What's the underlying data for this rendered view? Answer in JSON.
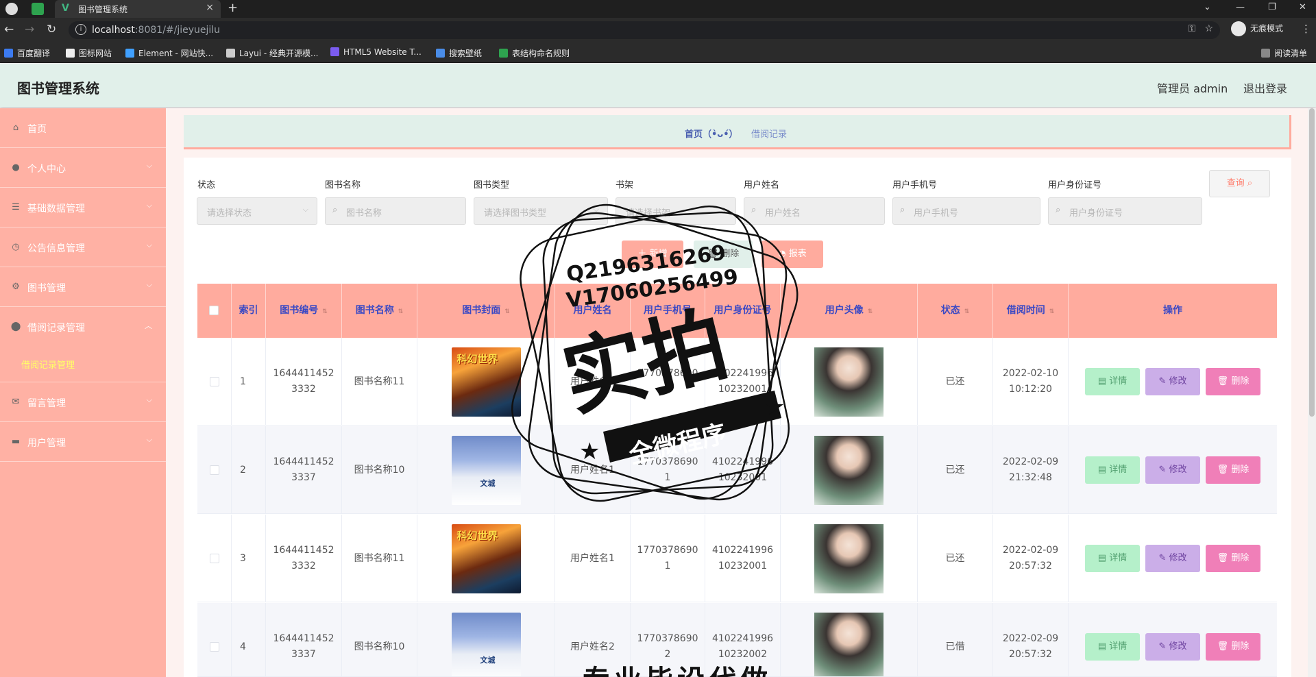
{
  "browser": {
    "tab_title": "图书管理系统",
    "tab_close": "×",
    "new_tab": "+",
    "url_host": "localhost",
    "url_path": ":8081/#/jieyuejilu",
    "incognito_label": "无痕模式",
    "bookmarks": [
      "百度翻译",
      "图标网站",
      "Element - 网站快...",
      "Layui - 经典开源模...",
      "HTML5 Website T...",
      "搜索壁纸",
      "表结构命名规则"
    ],
    "reading_list": "阅读清单"
  },
  "header": {
    "title": "图书管理系统",
    "user": "管理员 admin",
    "logout": "退出登录"
  },
  "sidebar": {
    "items": [
      {
        "label": "首页",
        "icon": "home-icon"
      },
      {
        "label": "个人中心",
        "icon": "user-icon"
      },
      {
        "label": "基础数据管理",
        "icon": "list-icon"
      },
      {
        "label": "公告信息管理",
        "icon": "clock-icon"
      },
      {
        "label": "图书管理",
        "icon": "gear-icon"
      },
      {
        "label": "借阅记录管理",
        "icon": "pin-icon"
      },
      {
        "label": "留言管理",
        "icon": "mail-icon"
      },
      {
        "label": "用户管理",
        "icon": "monitor-icon"
      }
    ],
    "sub_active": "借阅记录管理"
  },
  "breadcrumb": {
    "home": "首页（•̀ᴗ•́）",
    "current": "借阅记录"
  },
  "filters": [
    {
      "label": "状态",
      "placeholder": "请选择状态",
      "type": "select"
    },
    {
      "label": "图书名称",
      "placeholder": "图书名称",
      "type": "search"
    },
    {
      "label": "图书类型",
      "placeholder": "请选择图书类型",
      "type": "select"
    },
    {
      "label": "书架",
      "placeholder": "请选择书架",
      "type": "select"
    },
    {
      "label": "用户姓名",
      "placeholder": "用户姓名",
      "type": "search"
    },
    {
      "label": "用户手机号",
      "placeholder": "用户手机号",
      "type": "search"
    },
    {
      "label": "用户身份证号",
      "placeholder": "用户身份证号",
      "type": "search"
    }
  ],
  "actions": {
    "query": "查询",
    "add": "新增",
    "delete": "删除",
    "report": "报表"
  },
  "table": {
    "headers": [
      "索引",
      "图书编号",
      "图书名称",
      "图书封面",
      "用户姓名",
      "用户手机号",
      "用户身份证号",
      "用户头像",
      "状态",
      "借阅时间",
      "操作"
    ],
    "rows": [
      {
        "index": "1",
        "book_no_1": "1644411452",
        "book_no_2": "3332",
        "book_name": "图书名称11",
        "cover": "科幻世界",
        "user_name": "用户姓名1",
        "phone_1": "1770378690",
        "phone_2": "1",
        "id_1": "4102241996",
        "id_2": "10232001",
        "status": "已还",
        "date": "2022-02-10",
        "time": "10:12:20"
      },
      {
        "index": "2",
        "book_no_1": "1644411452",
        "book_no_2": "3337",
        "book_name": "图书名称10",
        "cover": "文城",
        "user_name": "用户姓名1",
        "phone_1": "1770378690",
        "phone_2": "1",
        "id_1": "4102241996",
        "id_2": "10232001",
        "status": "已还",
        "date": "2022-02-09",
        "time": "21:32:48"
      },
      {
        "index": "3",
        "book_no_1": "1644411452",
        "book_no_2": "3332",
        "book_name": "图书名称11",
        "cover": "科幻世界",
        "user_name": "用户姓名1",
        "phone_1": "1770378690",
        "phone_2": "1",
        "id_1": "4102241996",
        "id_2": "10232001",
        "status": "已还",
        "date": "2022-02-09",
        "time": "20:57:32"
      },
      {
        "index": "4",
        "book_no_1": "1644411452",
        "book_no_2": "3337",
        "book_name": "图书名称10",
        "cover": "文城",
        "user_name": "用户姓名2",
        "phone_1": "1770378690",
        "phone_2": "2",
        "id_1": "4102241996",
        "id_2": "10232002",
        "status": "已借",
        "date": "2022-02-09",
        "time": "20:57:32"
      }
    ],
    "op_detail": "详情",
    "op_edit": "修改",
    "op_delete": "删除"
  },
  "watermark": {
    "qq": "Q2196316269",
    "vx": "V17060256499",
    "big": "实拍",
    "banner": "全微程序",
    "bottom": "专业毕设代做"
  },
  "colors": {
    "header_bg": "#e1f0ea",
    "sidebar_bg": "#ffb1a4",
    "table_head_bg": "#ffab9e",
    "detail_btn": "#b5f0ca",
    "edit_btn": "#cbaee8",
    "delete_btn": "#f07fb8"
  }
}
